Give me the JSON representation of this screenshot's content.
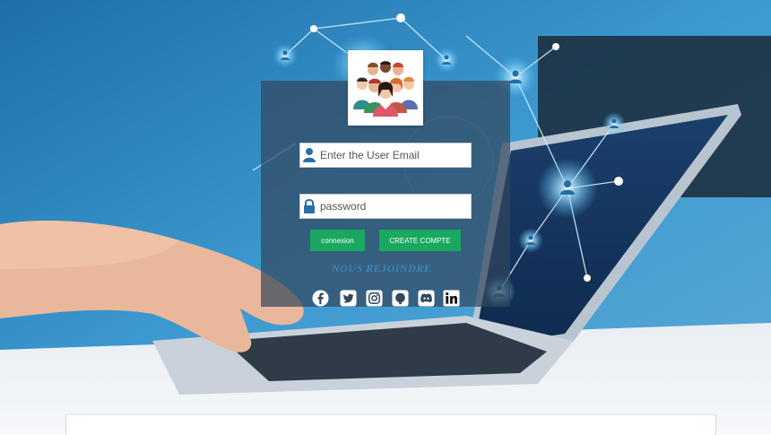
{
  "login": {
    "email": {
      "placeholder": "Enter the User Email",
      "value": ""
    },
    "password": {
      "placeholder": "password",
      "value": ""
    },
    "login_button": "connexion",
    "create_button": "CREATE COMPTE",
    "join_link": "NOUS REJOINDRE"
  },
  "socials": [
    {
      "icon": "facebook-icon"
    },
    {
      "icon": "twitter-icon"
    },
    {
      "icon": "instagram-icon"
    },
    {
      "icon": "github-icon"
    },
    {
      "icon": "discord-icon"
    },
    {
      "icon": "linkedin-icon"
    }
  ],
  "colors": {
    "card": "#32465c",
    "button": "#1aa860",
    "accent": "#3b84c0",
    "field_icon": "#2a6fad"
  }
}
